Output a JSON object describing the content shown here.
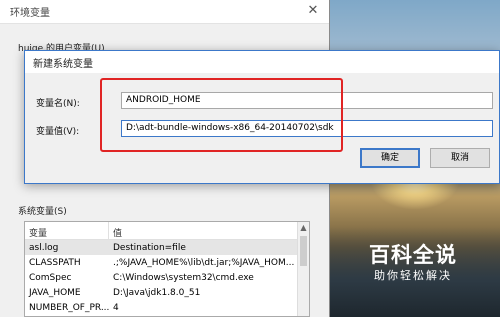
{
  "env_window": {
    "title": "环境变量",
    "close_glyph": "✕",
    "user_vars_label": "huige 的用户变量(U)",
    "system_vars_label": "系统变量(S)",
    "system_table": {
      "columns": [
        "变量",
        "值"
      ],
      "rows": [
        {
          "name": "asl.log",
          "value": "Destination=file",
          "selected": true
        },
        {
          "name": "CLASSPATH",
          "value": ".;%JAVA_HOME%\\lib\\dt.jar;%JAVA_HOM..."
        },
        {
          "name": "ComSpec",
          "value": "C:\\Windows\\system32\\cmd.exe"
        },
        {
          "name": "JAVA_HOME",
          "value": "D:\\Java\\jdk1.8.0_51"
        },
        {
          "name": "NUMBER_OF_PR...",
          "value": "4"
        }
      ]
    }
  },
  "new_var_dialog": {
    "title": "新建系统变量",
    "name_label": "变量名(N):",
    "name_value": "ANDROID_HOME",
    "value_label": "变量值(V):",
    "value_value": "D:\\adt-bundle-windows-x86_64-20140702\\sdk",
    "ok_label": "确定",
    "cancel_label": "取消"
  },
  "watermark": {
    "title": "百科全说",
    "subtitle": "助你轻松解决"
  },
  "colors": {
    "highlight": "#e02424",
    "accent": "#3c78c9"
  }
}
